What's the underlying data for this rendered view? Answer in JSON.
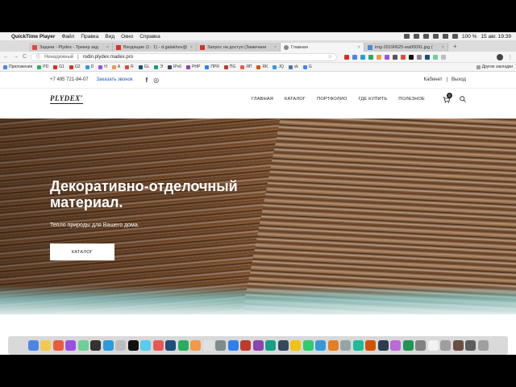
{
  "menubar": {
    "app_name": "QuickTime Player",
    "items": [
      "Файл",
      "Правка",
      "Вид",
      "Окно",
      "Справка"
    ],
    "battery": "100 %",
    "datetime": "15 авг.  19:39"
  },
  "tabs": [
    {
      "label": "Задачи - Plydex - Трекер зад",
      "color": "#e04a3f",
      "active": false
    },
    {
      "label": "Входящие (1 : 1) - d.galakhov@",
      "color": "#d93025",
      "active": false
    },
    {
      "label": "Запрос на доступ (Замечани",
      "color": "#d93025",
      "active": false
    },
    {
      "label": "Главная",
      "color": "#888888",
      "active": true
    },
    {
      "label": "img-20190625-wa00091.jpg (",
      "color": "#4b8bd6",
      "active": false
    }
  ],
  "address": {
    "insecure_label": "Ненадежный",
    "url": "rodin.plydex.madex.pro"
  },
  "bookmarks": {
    "apps_label": "Приложения",
    "items": [
      "PD",
      "G1",
      "G2",
      "D",
      "H",
      "A",
      "R",
      "GL",
      "Э",
      "IPv6",
      "PHP",
      "ПРЯ",
      "ПG",
      "ЯП",
      "RK",
      "JQ",
      "vk",
      "G"
    ],
    "other": "Другие закладки"
  },
  "site": {
    "phone": "+7 495 721-84-07",
    "callback": "Заказать звонок",
    "cabinet": "Кабинет",
    "exit": "Выход",
    "logo": "PLYDEX",
    "nav": [
      "ГЛАВНАЯ",
      "КАТАЛОГ",
      "ПОРТФОЛИО",
      "ГДЕ КУПИТЬ",
      "ПОЛЕЗНОЕ"
    ],
    "cart_count": "0",
    "hero_title": "Декоративно-отделочный материал.",
    "hero_subtitle": "Тепло природы для Вашего дома.",
    "hero_button": "КАТАЛОГ"
  },
  "dock_colors": [
    "#4a86e8",
    "#f2c94c",
    "#e85d3f",
    "#9b51e0",
    "#6fcf97",
    "#333333",
    "#2d9cdb",
    "#bdbdbd",
    "#111111",
    "#56ccf2",
    "#eb5757",
    "#1f4e79",
    "#27ae60",
    "#f2994a",
    "#e0e0e0",
    "#7f8c8d",
    "#2f80ed",
    "#c0392b",
    "#8e44ad",
    "#16a085",
    "#34495e",
    "#f1c40f",
    "#2ecc71",
    "#3498db",
    "#e67e22",
    "#95a5a6",
    "#1abc9c",
    "#d35400",
    "#2c3e50",
    "#bb6bd9",
    "#219653",
    "#828282",
    "#f2f2f2",
    "#9e9e9e",
    "#6d4c41",
    "#5d5d5d",
    "#a0a0a0"
  ]
}
